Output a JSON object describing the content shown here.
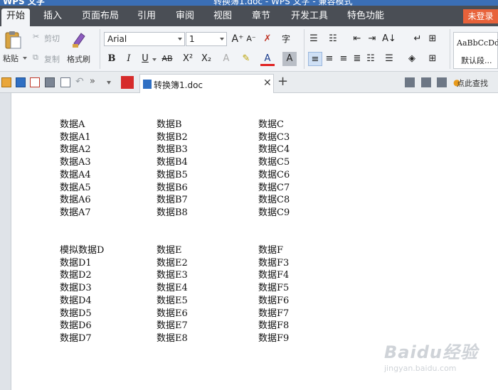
{
  "window": {
    "app_name": "WPS 文字",
    "doc_title": "转换簿1.doc - WPS 文字 - 兼容模式"
  },
  "menu": {
    "tabs": [
      "开始",
      "插入",
      "页面布局",
      "引用",
      "审阅",
      "视图",
      "章节",
      "开发工具",
      "特色功能"
    ],
    "active": "开始",
    "login": "未登录"
  },
  "ribbon": {
    "paste": "粘贴",
    "cut": "剪切",
    "copy": "复制",
    "format_painter": "格式刷",
    "font_name": "Arial",
    "font_size": "1",
    "style_preview": "AaBbCcDd",
    "style_name": "默认段..."
  },
  "tabs": {
    "document": "转换簿1.doc",
    "search_hint": "点此查找"
  },
  "table1": {
    "rows": [
      [
        "数据A",
        "数据B",
        "数据C"
      ],
      [
        "数据A1",
        "数据B2",
        "数据C3"
      ],
      [
        "数据A2",
        "数据B3",
        "数据C4"
      ],
      [
        "数据A3",
        "数据B4",
        "数据C5"
      ],
      [
        "数据A4",
        "数据B5",
        "数据C6"
      ],
      [
        "数据A5",
        "数据B6",
        "数据C7"
      ],
      [
        "数据A6",
        "数据B7",
        "数据C8"
      ],
      [
        "数据A7",
        "数据B8",
        "数据C9"
      ]
    ]
  },
  "table2": {
    "rows": [
      [
        "模拟数据D",
        "数据E",
        "数据F"
      ],
      [
        "数据D1",
        "数据E2",
        "数据F3"
      ],
      [
        "数据D2",
        "数据E3",
        "数据F4"
      ],
      [
        "数据D3",
        "数据E4",
        "数据F5"
      ],
      [
        "数据D4",
        "数据E5",
        "数据F6"
      ],
      [
        "数据D5",
        "数据E6",
        "数据F7"
      ],
      [
        "数据D6",
        "数据E7",
        "数据F8"
      ],
      [
        "数据D7",
        "数据E8",
        "数据F9"
      ]
    ]
  },
  "watermark": {
    "brand": "Baidu经验",
    "url": "jingyan.baidu.com"
  }
}
